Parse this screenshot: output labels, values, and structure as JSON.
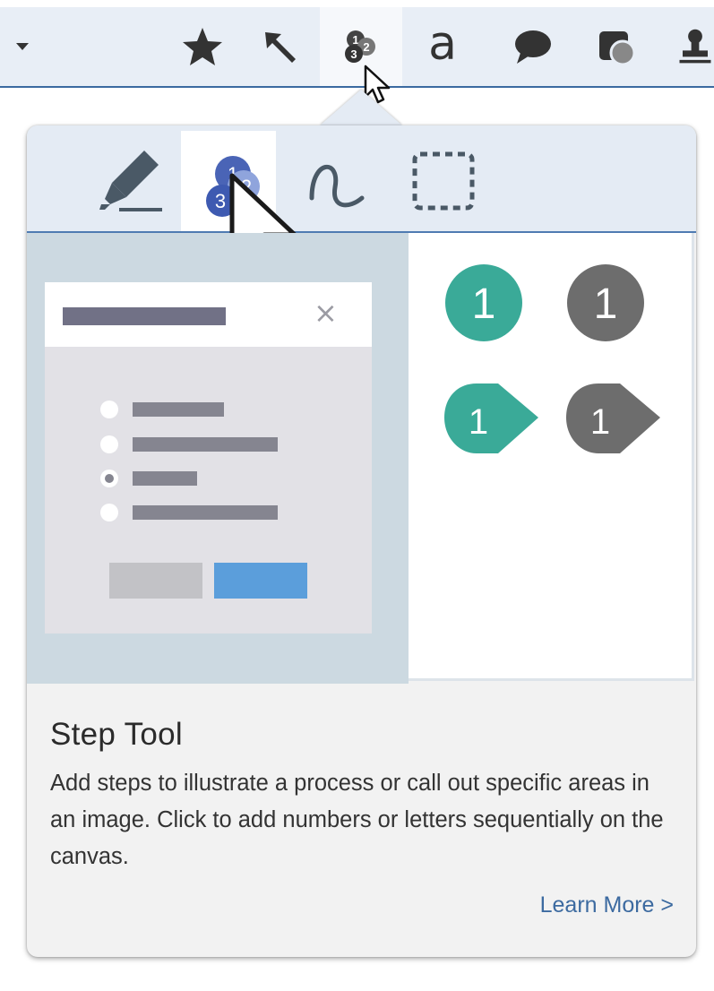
{
  "toolbar": {
    "items": [
      {
        "name": "dropdown-caret",
        "icon": "caret-down-icon"
      },
      {
        "name": "favorites",
        "icon": "star-icon"
      },
      {
        "name": "arrow",
        "icon": "arrow-icon"
      },
      {
        "name": "step",
        "icon": "step-icon",
        "active": true
      },
      {
        "name": "text",
        "icon": "text-a-icon",
        "label": "a"
      },
      {
        "name": "callout",
        "icon": "speech-bubble-icon"
      },
      {
        "name": "shape",
        "icon": "shape-icon"
      },
      {
        "name": "stamp",
        "icon": "stamp-icon"
      }
    ]
  },
  "popup": {
    "tools": [
      {
        "name": "highlighter",
        "icon": "highlighter-icon"
      },
      {
        "name": "step",
        "icon": "step-tool-icon",
        "active": true
      },
      {
        "name": "pen",
        "icon": "pen-curve-icon"
      },
      {
        "name": "selection",
        "icon": "selection-icon"
      }
    ],
    "preview": {
      "close_glyph": "×",
      "step_labels": [
        "1",
        "1",
        "1",
        "1"
      ],
      "step_colors": {
        "teal": "#3aaa98",
        "gray": "#6d6d6d"
      }
    },
    "title": "Step Tool",
    "description": "Add steps to illustrate a process or call out specific areas in an image. Click to add numbers or letters sequentially on the canvas.",
    "learn_more": "Learn More >"
  },
  "colors": {
    "toolbar_bg": "#e8eef6",
    "accent": "#3b6aa0",
    "popup_bg": "#f2f2f2",
    "link": "#3c6aa0"
  }
}
